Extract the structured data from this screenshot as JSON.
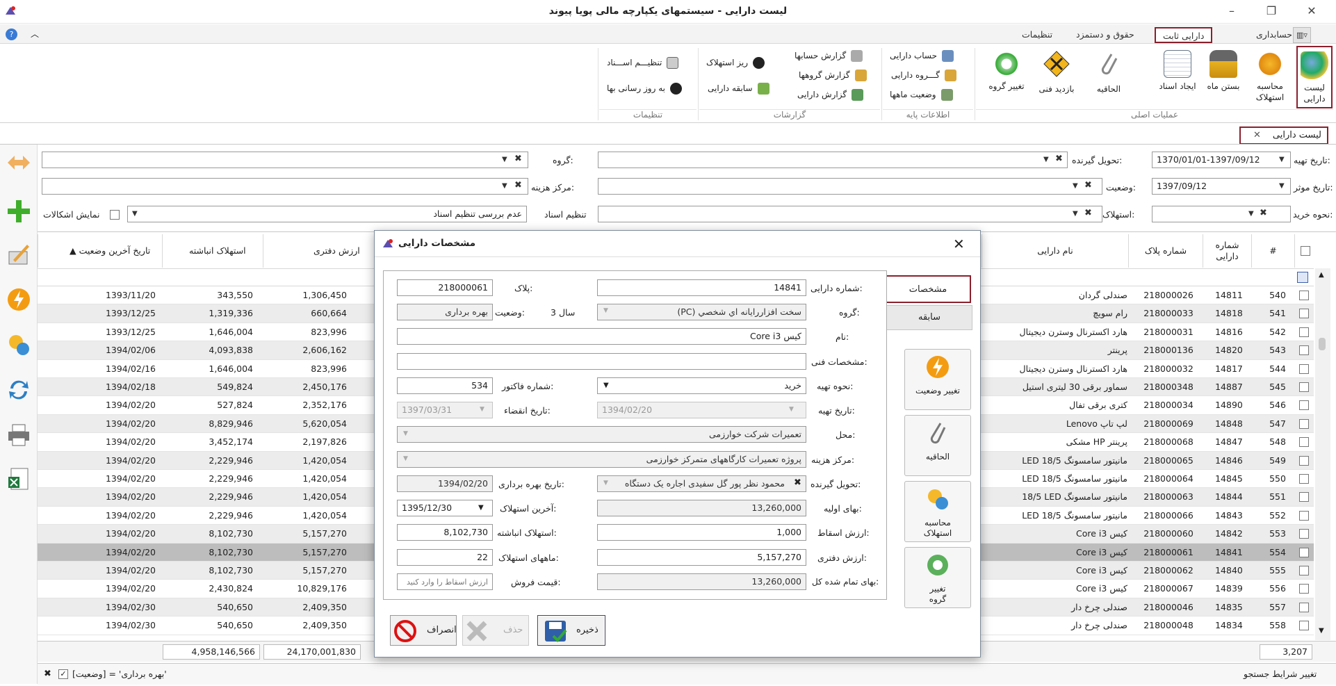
{
  "app": {
    "title": "لیست دارایی - سیستمهای یکپارچه مالی پویا پیوند"
  },
  "tabs": [
    "حسابداری",
    "دارایی ثابت",
    "حقوق و دستمزد",
    "تنظیمات"
  ],
  "ribbon": {
    "main_ops": {
      "group": "عملیات اصلی",
      "items": [
        "لیست دارایی",
        "محاسبه استهلاک",
        "بستن ماه",
        "ایجاد اسناد",
        "الحاقیه",
        "بازدید فنی",
        "تغییر گروه"
      ]
    },
    "base_info": {
      "group": "اطلاعات پایه",
      "items": [
        "حساب دارایی",
        "گـــروه دارایی",
        "وضعیت ماهها"
      ]
    },
    "reports": {
      "group": "گزارشات",
      "items": [
        "گزارش حسابها",
        "گزارش گروهها",
        "گزارش دارایی",
        "ریز استهلاک",
        "سابقه دارایی"
      ]
    },
    "settings": {
      "group": "تنظیمات",
      "items": [
        "تنظیـــم اســـناد",
        "به روز رسانی بها"
      ]
    }
  },
  "doc_tab": "لیست دارایی",
  "filters": {
    "issue_date_label": "تاریخ تهیه:",
    "issue_date": "1370/01/01-1397/09/12",
    "effective_date_label": "تاریخ موثر:",
    "effective_date": "1397/09/12",
    "purchase_label": "نحوه خرید:",
    "receiver_label": "تحویل گیرنده:",
    "status_label": "وضعیت:",
    "depreciation_label": "استهلاک:",
    "group_label": "گروه:",
    "cost_center_label": "مرکز هزینه:",
    "doc_setting_label": "تنظیم اسناد",
    "doc_setting_value": "عدم بررسی تنظیم اسناد",
    "show_problems": "نمایش اشکالات"
  },
  "columns": {
    "num": "#",
    "asset_no": "شماره دارایی",
    "plate": "شماره پلاک",
    "name": "نام دارایی",
    "book": "ارزش دفتری",
    "accum": "استهلاک انباشته",
    "last_date": "▲ تاریخ آخرین وضعیت"
  },
  "rows": [
    {
      "n": "540",
      "no": "14811",
      "plate": "218000026",
      "name": "صندلی گردان",
      "book": "1,306,450",
      "acc": "343,550",
      "date": "1393/11/20"
    },
    {
      "n": "541",
      "no": "14818",
      "plate": "218000033",
      "name": "رام سویچ",
      "book": "660,664",
      "acc": "1,319,336",
      "date": "1393/12/25"
    },
    {
      "n": "542",
      "no": "14816",
      "plate": "218000031",
      "name": "هارد اکسترنال وسترن دیجیتال",
      "book": "823,996",
      "acc": "1,646,004",
      "date": "1393/12/25"
    },
    {
      "n": "543",
      "no": "14820",
      "plate": "218000136",
      "name": "پرینتر",
      "book": "2,606,162",
      "acc": "4,093,838",
      "date": "1394/02/06"
    },
    {
      "n": "544",
      "no": "14817",
      "plate": "218000032",
      "name": "هارد اکسترنال وسترن دیجیتال",
      "book": "823,996",
      "acc": "1,646,004",
      "date": "1394/02/16"
    },
    {
      "n": "545",
      "no": "14887",
      "plate": "218000348",
      "name": "سماور برقی 30 لیتری استیل",
      "book": "2,450,176",
      "acc": "549,824",
      "date": "1394/02/18"
    },
    {
      "n": "546",
      "no": "14890",
      "plate": "218000034",
      "name": "کتری برقی تفال",
      "book": "2,352,176",
      "acc": "527,824",
      "date": "1394/02/20"
    },
    {
      "n": "547",
      "no": "14848",
      "plate": "218000069",
      "name": "Lenovo لپ تاپ",
      "book": "5,620,054",
      "acc": "8,829,946",
      "date": "1394/02/20"
    },
    {
      "n": "548",
      "no": "14847",
      "plate": "218000068",
      "name": "مشکی HP پرینتر",
      "book": "2,197,826",
      "acc": "3,452,174",
      "date": "1394/02/20"
    },
    {
      "n": "549",
      "no": "14846",
      "plate": "218000065",
      "name": "LED مانیتور سامسونگ 18/5",
      "book": "1,420,054",
      "acc": "2,229,946",
      "date": "1394/02/20"
    },
    {
      "n": "550",
      "no": "14845",
      "plate": "218000064",
      "name": "LED مانیتور سامسونگ 18/5",
      "book": "1,420,054",
      "acc": "2,229,946",
      "date": "1394/02/20"
    },
    {
      "n": "551",
      "no": "14844",
      "plate": "218000063",
      "name": "18/5 LED مانیتور سامسونگ",
      "book": "1,420,054",
      "acc": "2,229,946",
      "date": "1394/02/20"
    },
    {
      "n": "552",
      "no": "14843",
      "plate": "218000066",
      "name": "LED مانیتور سامسونگ 18/5",
      "book": "1,420,054",
      "acc": "2,229,946",
      "date": "1394/02/20"
    },
    {
      "n": "553",
      "no": "14842",
      "plate": "218000060",
      "name": "Core i3 کیس",
      "book": "5,157,270",
      "acc": "8,102,730",
      "date": "1394/02/20"
    },
    {
      "n": "554",
      "no": "14841",
      "plate": "218000061",
      "name": "Core i3 کیس",
      "book": "5,157,270",
      "acc": "8,102,730",
      "date": "1394/02/20"
    },
    {
      "n": "555",
      "no": "14840",
      "plate": "218000062",
      "name": "Core i3 کیس",
      "book": "5,157,270",
      "acc": "8,102,730",
      "date": "1394/02/20"
    },
    {
      "n": "556",
      "no": "14839",
      "plate": "218000067",
      "name": "Core i3 کیس",
      "book": "10,829,176",
      "acc": "2,430,824",
      "date": "1394/02/20"
    },
    {
      "n": "557",
      "no": "14835",
      "plate": "218000046",
      "name": "صندلی چرخ دار",
      "book": "2,409,350",
      "acc": "540,650",
      "date": "1394/02/30"
    },
    {
      "n": "558",
      "no": "14834",
      "plate": "218000048",
      "name": "صندلی چرخ دار",
      "book": "2,409,350",
      "acc": "540,650",
      "date": "1394/02/30"
    }
  ],
  "totals": {
    "count": "3,207",
    "book": "24,170,001,830",
    "accum": "4,958,146,566"
  },
  "status": {
    "filter_expr": "[وضعیت] = 'بهره برداری'",
    "change_link": "تغییر شرایط جستجو"
  },
  "dialog": {
    "title": "مشخصات دارایی",
    "vtabs": [
      "مشخصات",
      "سابقه"
    ],
    "side_buttons": [
      "تغییر وضعیت",
      "الحاقیه",
      "محاسبه استهلاک",
      "تغییر گروه"
    ],
    "fields": {
      "asset_no_label": "شماره دارایی:",
      "asset_no": "14841",
      "plate_label": "پلاک:",
      "plate": "218000061",
      "group_label": "گروه:",
      "group": "سخت افزاررایانه اي شخصي (PC)",
      "group_years": "3 سال",
      "status_label": "وضعیت:",
      "status": "بهره برداری",
      "name_label": "نام:",
      "name": "کیس Core i3",
      "tech_label": "مشخصات فنی:",
      "tech": "",
      "purchase_label": "نحوه تهیه:",
      "purchase": "خرید",
      "invoice_label": "شماره فاکتور:",
      "invoice": "534",
      "issue_date_label": "تاریخ تهیه:",
      "issue_date": "1394/02/20",
      "expire_label": "تاریخ انقضاء:",
      "expire": "1397/03/31",
      "location_label": "محل:",
      "location": "تعمیرات شرکت خوارزمی",
      "cost_center_label": "مرکز هزینه:",
      "cost_center": "پروژه تعمیرات کارگاههای متمرکز خوارزمی",
      "receiver_label": "تحویل گیرنده:",
      "receiver": "محمود نظر پور گل سفیدی اجاره یک دستگاه",
      "util_date_label": "تاریخ بهره برداری:",
      "util_date": "1394/02/20",
      "initial_label": "بهای اولیه:",
      "initial": "13,260,000",
      "last_dep_label": "آخرین استهلاک:",
      "last_dep": "1395/12/30",
      "salvage_label": "ارزش اسقاط:",
      "salvage": "1,000",
      "accum_label": "استهلاک انباشته:",
      "accum": "8,102,730",
      "book_label": "ارزش دفتری:",
      "book": "5,157,270",
      "months_label": "ماههای استهلاک:",
      "months": "22",
      "total_cost_label": "بهای تمام شده کل:",
      "total_cost": "13,260,000",
      "sale_label": "قیمت فروش:",
      "sale_placeholder": "ارزش اسقاط را وارد کنید"
    },
    "buttons": {
      "save": "ذخیره",
      "delete": "حذف",
      "cancel": "انصراف"
    }
  },
  "colors": {
    "accent": "#8b1f2c",
    "selected_row": "#bdbdbd"
  },
  "icons": [
    "app-logo-icon",
    "minimize-icon",
    "maximize-icon",
    "close-icon",
    "help-icon",
    "collapse-icon",
    "layout-icon"
  ]
}
